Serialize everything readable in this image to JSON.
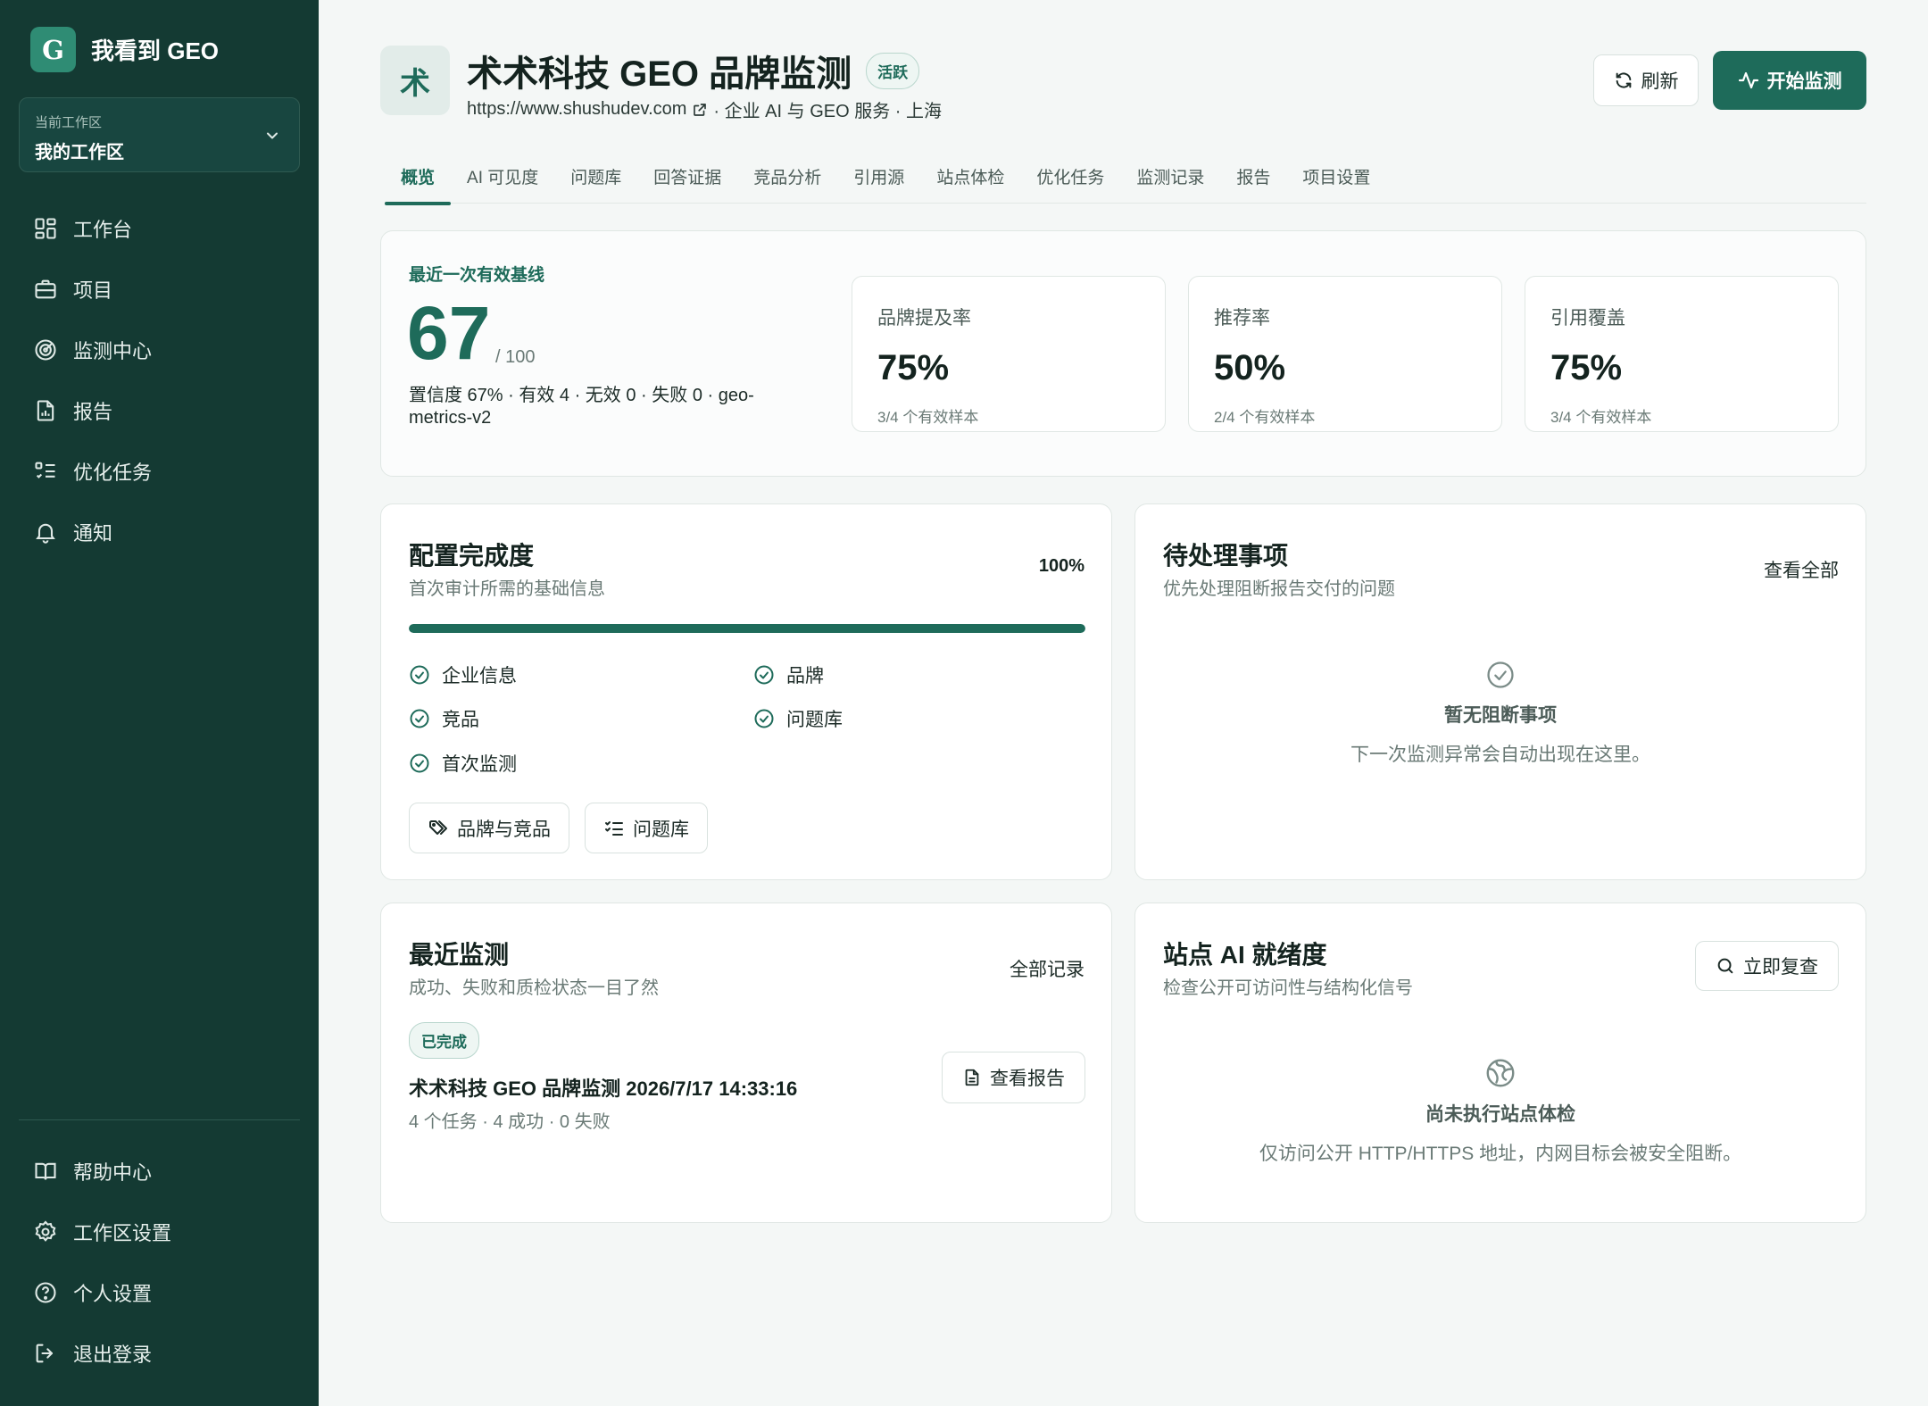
{
  "brand": {
    "logo_letter": "G",
    "name": "我看到 GEO"
  },
  "workspace": {
    "caption": "当前工作区",
    "value": "我的工作区"
  },
  "sidebar": {
    "items": [
      {
        "label": "工作台",
        "icon": "dashboard-icon"
      },
      {
        "label": "项目",
        "icon": "briefcase-icon"
      },
      {
        "label": "监测中心",
        "icon": "radar-icon"
      },
      {
        "label": "报告",
        "icon": "report-icon"
      },
      {
        "label": "优化任务",
        "icon": "task-list-icon"
      },
      {
        "label": "通知",
        "icon": "bell-icon"
      }
    ],
    "bottom": [
      {
        "label": "帮助中心",
        "icon": "book-icon"
      },
      {
        "label": "工作区设置",
        "icon": "gear-icon"
      },
      {
        "label": "个人设置",
        "icon": "help-circle-icon"
      },
      {
        "label": "退出登录",
        "icon": "logout-icon"
      }
    ]
  },
  "project": {
    "avatar": "术",
    "title": "术术科技 GEO 品牌监测",
    "status": "活跃",
    "url": "https://www.shushudev.com",
    "meta": "· 企业 AI 与 GEO 服务 · 上海"
  },
  "actions": {
    "refresh": "刷新",
    "start": "开始监测"
  },
  "tabs": [
    "概览",
    "AI 可见度",
    "问题库",
    "回答证据",
    "竞品分析",
    "引用源",
    "站点体检",
    "优化任务",
    "监测记录",
    "报告",
    "项目设置"
  ],
  "active_tab": "概览",
  "baseline": {
    "label": "最近一次有效基线",
    "score": "67",
    "total": "/ 100",
    "detail": "置信度 67% · 有效 4 · 无效 0 · 失败 0 · geo-metrics-v2",
    "metrics": [
      {
        "label": "品牌提及率",
        "value": "75%",
        "sub": "3/4 个有效样本"
      },
      {
        "label": "推荐率",
        "value": "50%",
        "sub": "2/4 个有效样本"
      },
      {
        "label": "引用覆盖",
        "value": "75%",
        "sub": "3/4 个有效样本"
      }
    ]
  },
  "config": {
    "title": "配置完成度",
    "subtitle": "首次审计所需的基础信息",
    "percent_text": "100%",
    "progress": 1.0,
    "items": [
      "企业信息",
      "品牌",
      "竞品",
      "问题库",
      "首次监测"
    ],
    "buttons": [
      "品牌与竞品",
      "问题库"
    ]
  },
  "todo": {
    "title": "待处理事项",
    "subtitle": "优先处理阻断报告交付的问题",
    "link": "查看全部",
    "empty_title": "暂无阻断事项",
    "empty_desc": "下一次监测异常会自动出现在这里。"
  },
  "recent": {
    "title": "最近监测",
    "subtitle": "成功、失败和质检状态一目了然",
    "link": "全部记录",
    "badge": "已完成",
    "run_title": "术术科技 GEO 品牌监测 2026/7/17 14:33:16",
    "run_sub": "4 个任务 · 4 成功 · 0 失败",
    "report_button": "查看报告"
  },
  "site": {
    "title": "站点 AI 就绪度",
    "subtitle": "检查公开可访问性与结构化信号",
    "button": "立即复查",
    "empty_title": "尚未执行站点体检",
    "empty_desc": "仅访问公开 HTTP/HTTPS 地址，内网目标会被安全阻断。"
  },
  "colors": {
    "sidebar_bg": "#143a33",
    "accent": "#1e6b5a",
    "logo_bg": "#2f8c74",
    "page_bg": "#f4f7f6"
  }
}
